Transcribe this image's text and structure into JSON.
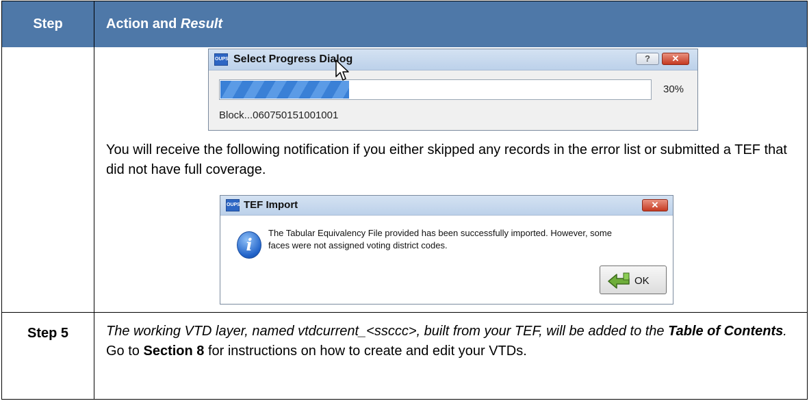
{
  "header": {
    "step_label": "Step",
    "action_label": "Action and ",
    "action_italic": "Result"
  },
  "progress_dialog": {
    "app_icon": "OUPS",
    "title": "Select Progress Dialog",
    "help_glyph": "?",
    "close_glyph": "✕",
    "progress_fraction": 0.3,
    "percent_text": "30%",
    "status_text": "Block...060750151001001"
  },
  "notification_text": "You will receive the following notification if you either skipped any records in the error list or submitted a TEF that did not have full coverage.",
  "tef_dialog": {
    "app_icon": "OUPS",
    "title": "TEF Import",
    "close_glyph": "✕",
    "info_glyph": "i",
    "message_line1": "The Tabular Equivalency File provided has been successfully imported. However, some",
    "message_line2": "faces were not assigned voting district codes.",
    "ok_label": "OK"
  },
  "step5": {
    "label": "Step 5",
    "text_part1": "The working VTD layer, named vtdcurrent_<ssccc>, built from your TEF, will be added to the ",
    "text_bold_italic": "Table of Contents",
    "text_part2": ".",
    "text_part3": " Go to ",
    "text_bold": "Section 8",
    "text_part4": " for instructions on how to create and edit your VTDs."
  },
  "colors": {
    "header_bg": "#4e78a8",
    "progress_fill": "#3a80d6"
  },
  "icons": [
    "oups-app-icon",
    "help-icon",
    "close-icon",
    "mouse-cursor-icon",
    "info-icon",
    "green-arrow-icon"
  ]
}
